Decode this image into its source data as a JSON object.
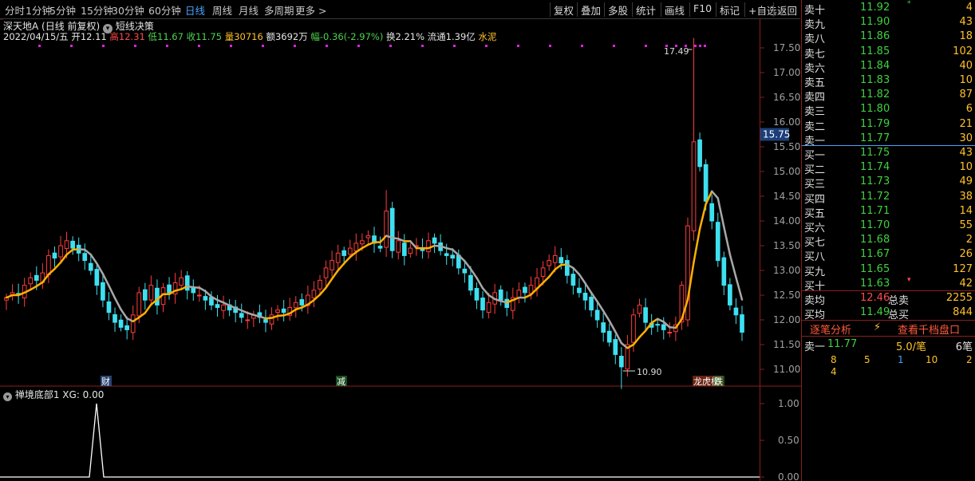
{
  "toolbar": {
    "periods": [
      "分时",
      "1分钟",
      "5分钟",
      "15分钟",
      "30分钟",
      "60分钟",
      "日线",
      "周线",
      "月线",
      "多周期",
      "更多 >"
    ],
    "active_period": "日线",
    "tools": [
      "复权",
      "叠加",
      "多股",
      "统计",
      "画线",
      "F10",
      "标记",
      "+自选",
      "返回"
    ]
  },
  "stock": {
    "name": "深天地A",
    "mode": "(日线 前复权)",
    "indicator_name": "短线决策"
  },
  "bar_info": {
    "date": "2022/04/15/五",
    "open_label": "开",
    "open": "12.11",
    "high_label": "高",
    "high": "12.31",
    "low_label": "低",
    "low": "11.67",
    "close_label": "收",
    "close": "11.75",
    "volume_label": "量",
    "volume": "30716",
    "amount_label": "额",
    "amount": "3692万",
    "change_label": "幅",
    "change": "-0.36(-2.97%)",
    "turnover_label": "换",
    "turnover": "2.21%",
    "float_label": "流通",
    "float_shares": "1.39亿",
    "sector": "水泥"
  },
  "price_axis": {
    "labels": [
      "17.50",
      "17.00",
      "16.50",
      "16.00",
      "15.50",
      "15.00",
      "14.50",
      "14.00",
      "13.50",
      "13.00",
      "12.50",
      "12.00",
      "11.50",
      "11.00"
    ],
    "current_tag": "15.75"
  },
  "annotations": {
    "max_label": "17.49",
    "min_label": "10.90",
    "event_markers": [
      "财",
      "减",
      "龙虎榜",
      "跌"
    ]
  },
  "indicator": {
    "title": "禅境底部1",
    "value_text": "XG: 0.00",
    "axis_labels": [
      "1.00",
      "0.50",
      "0.00"
    ]
  },
  "colors": {
    "up": "#ff3c3c",
    "down": "#3ee0f0",
    "ma_orange": "#ffb000",
    "ma_gray": "#a8a8a8",
    "buy_green": "#3fd13f",
    "volume_yellow": "#ffc22a",
    "axis_red": "#8a1e1e"
  },
  "orderbook": {
    "asks": [
      {
        "label": "卖十",
        "price": "11.92",
        "vol": "4",
        "mark": "*"
      },
      {
        "label": "卖九",
        "price": "11.90",
        "vol": "43"
      },
      {
        "label": "卖八",
        "price": "11.86",
        "vol": "18"
      },
      {
        "label": "卖七",
        "price": "11.85",
        "vol": "102"
      },
      {
        "label": "卖六",
        "price": "11.84",
        "vol": "40"
      },
      {
        "label": "卖五",
        "price": "11.83",
        "vol": "10"
      },
      {
        "label": "卖四",
        "price": "11.82",
        "vol": "87"
      },
      {
        "label": "卖三",
        "price": "11.80",
        "vol": "6"
      },
      {
        "label": "卖二",
        "price": "11.79",
        "vol": "21"
      },
      {
        "label": "卖一",
        "price": "11.77",
        "vol": "30"
      }
    ],
    "bids": [
      {
        "label": "买一",
        "price": "11.75",
        "vol": "43"
      },
      {
        "label": "买二",
        "price": "11.74",
        "vol": "10"
      },
      {
        "label": "买三",
        "price": "11.73",
        "vol": "49"
      },
      {
        "label": "买四",
        "price": "11.72",
        "vol": "38"
      },
      {
        "label": "买五",
        "price": "11.71",
        "vol": "14"
      },
      {
        "label": "买六",
        "price": "11.70",
        "vol": "55"
      },
      {
        "label": "买七",
        "price": "11.68",
        "vol": "2"
      },
      {
        "label": "买八",
        "price": "11.67",
        "vol": "26"
      },
      {
        "label": "买九",
        "price": "11.65",
        "vol": "127"
      },
      {
        "label": "买十",
        "price": "11.63",
        "vol": "42",
        "mark": "▾"
      }
    ],
    "summary": {
      "ask_avg_label": "卖均",
      "ask_avg": "12.46",
      "ask_total_label": "总卖",
      "ask_total": "2255",
      "bid_avg_label": "买均",
      "bid_avg": "11.49",
      "bid_total_label": "总买",
      "bid_total": "844"
    },
    "buttons": {
      "tick_analysis": "逐笔分析",
      "thousand_levels": "查看千档盘口"
    },
    "last_trade": {
      "label": "卖一",
      "price": "11.77",
      "avg": "5.0/笔",
      "count": "6笔"
    },
    "flow_row1": [
      "8",
      "5",
      "1",
      "10",
      "2"
    ],
    "flow_row2": [
      "4"
    ]
  }
}
